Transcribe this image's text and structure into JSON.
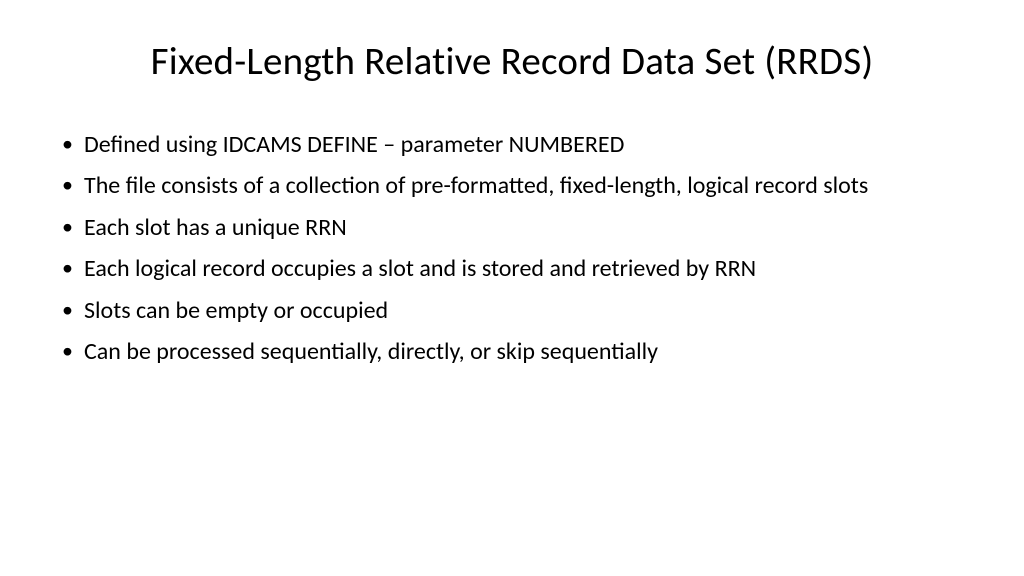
{
  "title": "Fixed-Length Relative Record Data Set (RRDS)",
  "bullets": [
    "Defined using IDCAMS DEFINE – parameter NUMBERED",
    "The file consists of a collection of pre-formatted, fixed-length, logical record slots",
    "Each slot has a unique RRN",
    "Each logical record occupies a slot and is stored and retrieved by RRN",
    "Slots can be empty or occupied",
    "Can be processed sequentially, directly, or skip sequentially"
  ]
}
